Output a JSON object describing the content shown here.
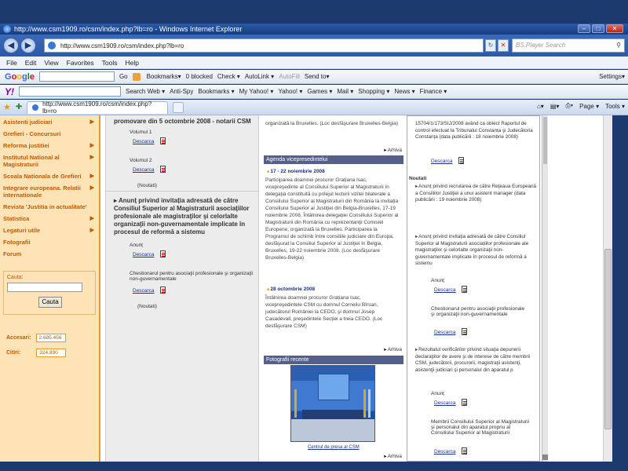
{
  "window": {
    "title": "http://www.csm1909.ro/csm/index.php?lb=ro - Windows Internet Explorer",
    "min": "–",
    "max": "□",
    "close": "✕"
  },
  "address": {
    "url": "http://www.csm1909.ro/csm/index.php?lb=ro",
    "search_placeholder": "BS.Player Search"
  },
  "menu": [
    "File",
    "Edit",
    "View",
    "Favorites",
    "Tools",
    "Help"
  ],
  "google_toolbar": {
    "go": "Go",
    "bookmarks": "Bookmarks▾",
    "blocked": "0 blocked",
    "check": "Check ▾",
    "autolink": "AutoLink ▾",
    "autofill": "AutoFill",
    "sendto": "Send to▾",
    "settings": "Settings▾"
  },
  "yahoo_toolbar": {
    "search_web": "Search Web ▾",
    "antispy": "Anti-Spy",
    "bookmarks": "Bookmarks ▾",
    "myyahoo": "My Yahoo! ▾",
    "yahoo": "Yahoo! ▾",
    "games": "Games ▾",
    "mail": "Mail ▾",
    "shopping": "Shopping ▾",
    "news": "News ▾",
    "finance": "Finance ▾"
  },
  "tab": {
    "label": "http://www.csm1909.ro/csm/index.php?lb=ro",
    "page": "Page ▾",
    "tools": "Tools ▾"
  },
  "sidebar": {
    "items": [
      {
        "label": "Asistenti judiciari",
        "arrow": true
      },
      {
        "label": "Grefieri - Concursuri",
        "arrow": false
      },
      {
        "label": "Reforma justitiei",
        "arrow": true
      },
      {
        "label": "Institutul National al Magistraturii",
        "arrow": true
      },
      {
        "label": "Scoala Nationala de Grefieri",
        "arrow": true
      },
      {
        "label": "Integrare europeana. Relatii internationale",
        "arrow": true
      },
      {
        "label": "Revista 'Justitia in actualitate'",
        "arrow": false
      },
      {
        "label": "Statistica",
        "arrow": true
      },
      {
        "label": "Legaturi utile",
        "arrow": true
      },
      {
        "label": "Fotografii",
        "arrow": false
      },
      {
        "label": "Forum",
        "arrow": false
      }
    ],
    "search_label": "Cauta:",
    "search_button": "Cauta",
    "accesari_label": "Accesari:",
    "accesari_value": "2.685.456",
    "citiri_label": "Citiri:",
    "citiri_value": "324.890"
  },
  "left_col": {
    "top_heading": "promovare din 5 octombrie 2008 - notarii CSM",
    "vol1": "Volumul 1",
    "vol2": "Volumul 2",
    "download": "Descarca",
    "noutati": "(Noutati)",
    "anunt_heading": "Anunț privind invitația adresată de către Consiliul Superior al Magistraturii asociaţiilor profesionale ale magistraţilor şi celorlalte organizaţii non-guvernamentale implicate în procesul de reformă a sistemu",
    "anunt": "Anunț",
    "chestionar": "Chestionarul pentru asociaţii profesionale şi organizaţii non-guvernamentale"
  },
  "mid_col": {
    "top_text": "organizată la Bruxelles. (Loc desfăşurare Bruxelles-Belgia)",
    "arhiva": "Arhiva",
    "agenda_title": "Agenda vicepresedintelui",
    "date1": "17 - 22 noiembrie 2008",
    "text1": "Participarea doamnei procuror Grațiana Isac, vicepreşedinte al Consiliului Superior al Magistraturii în delegaţia constituită cu prilejul lecturii vizitei bilaterale a Consiliului Superior al Magistraturii din România la invitația Consiliului Superior al Justiţiei din Belgia-Bruxelles, 17-19 noiembrie 2008. Întâlnirea delegației Consiliului Superior al Magistraturii din România cu reprezentanţii Comisiei Europene, organizată la Bruxelles. Participarea la Programul de schimb între consiliile judiciare din Europa, desfăşurat la Consiliul Superior al Justiţiei în Belgia, Bruxelles, 19-22 noiembrie 2008. (Loc desfăşurare Bruxelles-Belgia)",
    "date2": "28 octombrie 2008",
    "text2": "Întâlnirea doamnei procuror Grațiana Isac, vicepreşedintele CSM cu domnul Corneliu Bîrsan, judecătorul României la CEDO, şi domnul Josep Casadevall, preşedintele Secției a treia CEDO. (Loc desfăşurare CSM)",
    "foto_title": "Fotografii recente",
    "photo_caption": "Centrul de presa al CSM"
  },
  "right_col": {
    "top_text": "15704/1/173/SIJ/2008 având ca obiect Raportul de control efectuat la Tribunalul Constanța şi Judecătoria Constanța (data publicării : 18 noiembrie 2008)",
    "download": "Descarca",
    "noutati": "Noutati",
    "item1": "Anunț privind recrutarea de către Reţeaua Europeană a Consiliilor Justiţiei a unui asistent manager (data publicării : 19 noiembrie 2008)",
    "item2": "Anunț privind invitația adresată de către Consiliul Superior al Magistraturii asociațiilor profesionale ale magistraţilor şi celorlalte organizaţii non-guvernamentale implicate în procesul de reformă a sistemu",
    "anunt": "Anunț",
    "chestionar": "Chestionarul pentru asociaţii profesionale şi organizaţii non-guvernamentale",
    "item3": "Rezultatul verificărilor privind situaţia depunerii declaraţiilor de avere şi de interese de către membrii CSM, judecătorii, procurorii, magistraţii asistenţi, asistenţii judiciari şi personalul din aparatul p",
    "membrii": "Membrii Consiliului Superior al Magistraturii şi personalul din aparatul propriu al Consiliului Superior al Magistraturii"
  }
}
